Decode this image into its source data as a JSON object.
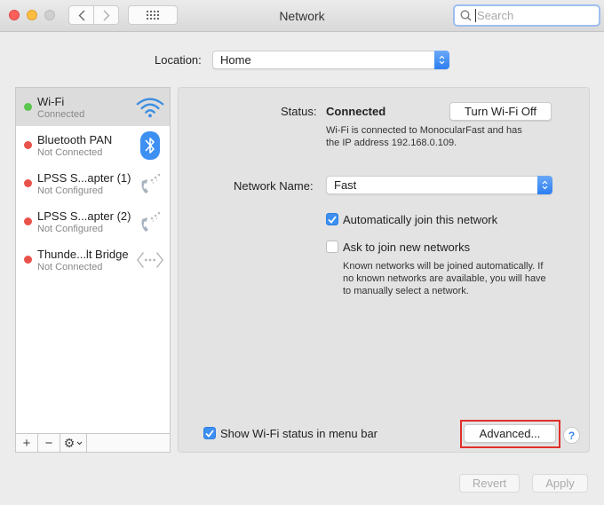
{
  "window": {
    "title": "Network",
    "search": {
      "placeholder": "Search",
      "value": ""
    }
  },
  "location": {
    "label": "Location:",
    "value": "Home"
  },
  "services": [
    {
      "name": "Wi-Fi",
      "status": "Connected",
      "status_color": "#5ac54f",
      "icon": "wifi-icon",
      "selected": true
    },
    {
      "name": "Bluetooth PAN",
      "status": "Not Connected",
      "status_color": "#e9524a",
      "icon": "bluetooth-icon",
      "selected": false
    },
    {
      "name": "LPSS S...apter (1)",
      "status": "Not Configured",
      "status_color": "#e9524a",
      "icon": "phone-icon",
      "selected": false
    },
    {
      "name": "LPSS S...apter (2)",
      "status": "Not Configured",
      "status_color": "#e9524a",
      "icon": "phone-icon",
      "selected": false
    },
    {
      "name": "Thunde...lt Bridge",
      "status": "Not Connected",
      "status_color": "#e9524a",
      "icon": "thunderbolt-bridge-icon",
      "selected": false
    }
  ],
  "list_footer": {
    "add": "+",
    "remove": "−",
    "gear": "⚙"
  },
  "detail": {
    "status_label": "Status:",
    "status_value": "Connected",
    "turn_off_button": "Turn Wi-Fi Off",
    "status_desc_line1": "Wi-Fi is connected to MonocularFast and has",
    "status_desc_line2": "the IP address 192.168.0.109.",
    "network_name_label": "Network Name:",
    "network_name_value": "Fast",
    "auto_join_label": "Automatically join this network",
    "auto_join_checked": true,
    "ask_join_label": "Ask to join new networks",
    "ask_join_checked": false,
    "ask_desc_line1": "Known networks will be joined automatically. If",
    "ask_desc_line2": "no known networks are available, you will have",
    "ask_desc_line3": "to manually select a network.",
    "show_status_label": "Show Wi-Fi status in menu bar",
    "show_status_checked": true,
    "advanced_button": "Advanced...",
    "help": "?"
  },
  "footer": {
    "revert": "Revert",
    "apply": "Apply"
  },
  "colors": {
    "accent": "#3d8ff2",
    "highlight_box": "#e0302a"
  }
}
